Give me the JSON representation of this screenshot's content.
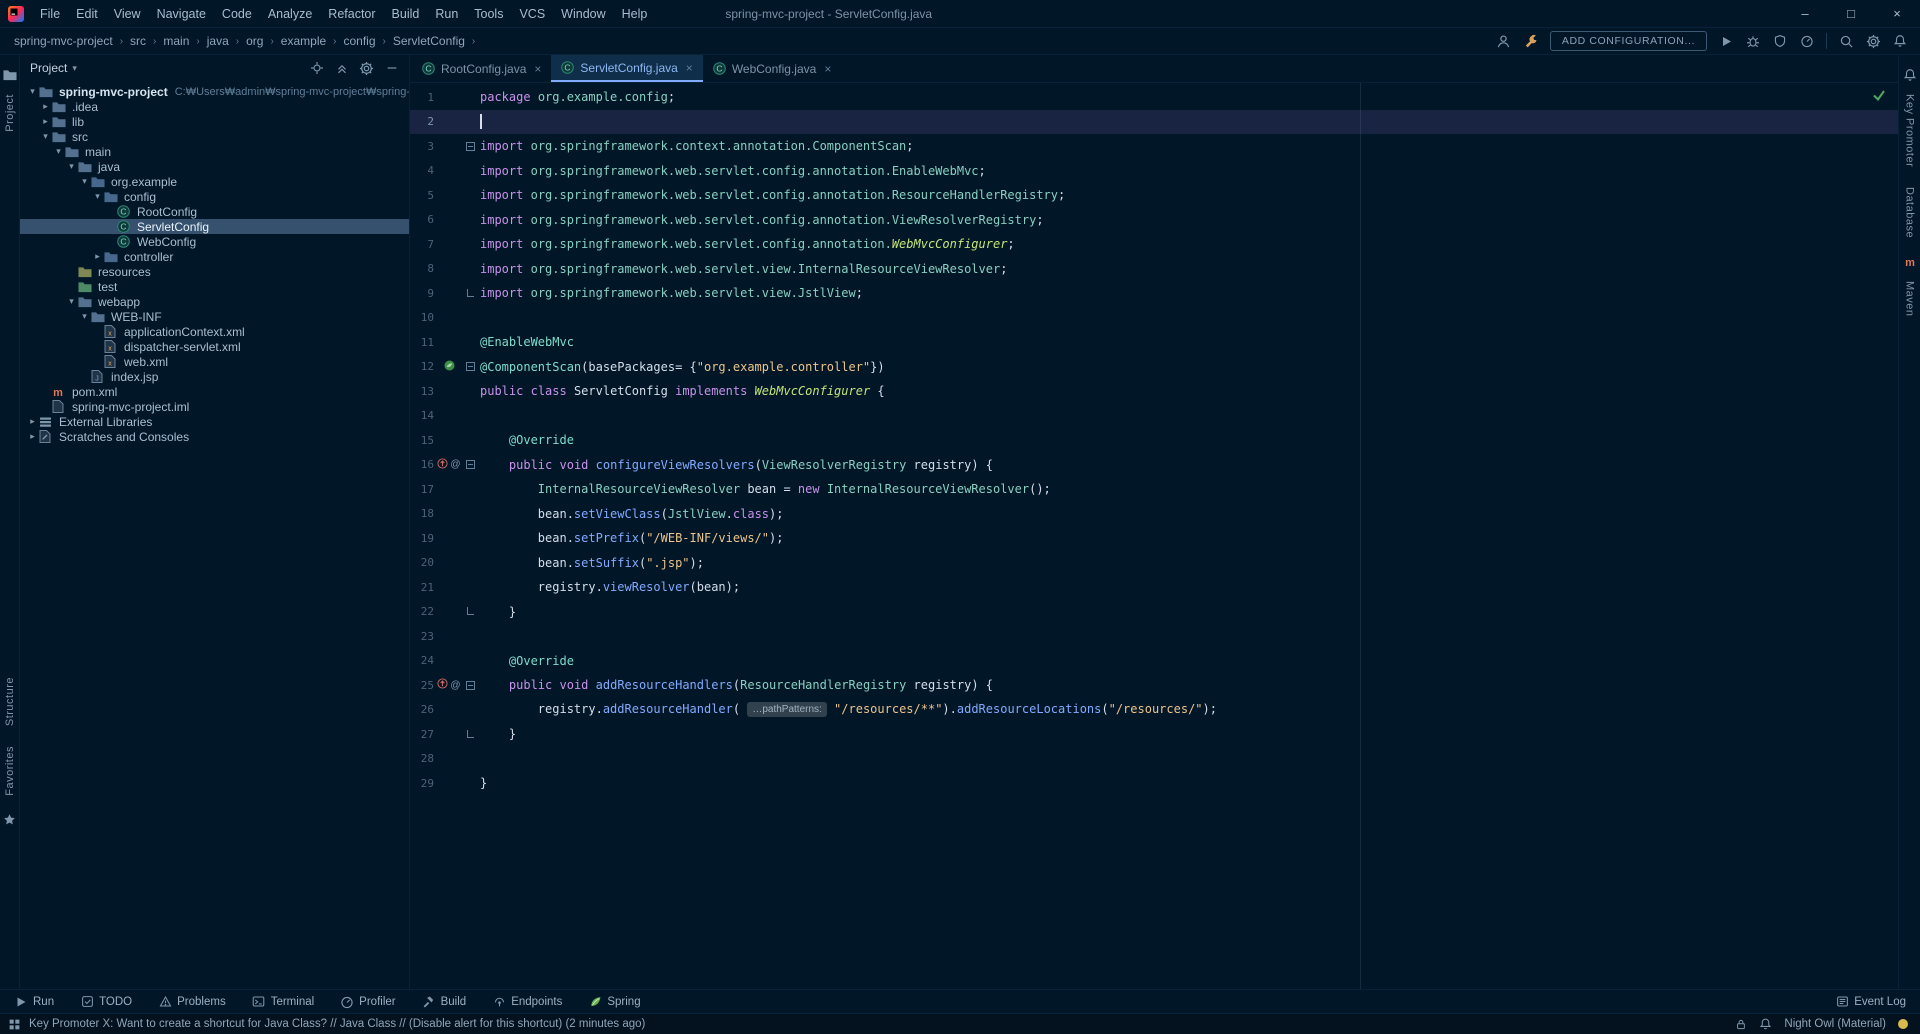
{
  "colors": {
    "bg": "#011627",
    "accent": "#82aaff",
    "keyword": "#c792ea",
    "string": "#ecc48d",
    "type": "#88d0c0",
    "interface": "#c5e478",
    "method": "#82aaff",
    "annotation": "#7fdbca",
    "text": "#d6deeb",
    "caret_line": "rgba(140,100,200,.18)",
    "selection": "#35516d",
    "check_green": "#4fa865",
    "spring_green": "#499c54",
    "theme_dot": "#d7ba4d"
  },
  "window": {
    "menus": [
      "File",
      "Edit",
      "View",
      "Navigate",
      "Code",
      "Analyze",
      "Refactor",
      "Build",
      "Run",
      "Tools",
      "VCS",
      "Window",
      "Help"
    ],
    "title": "spring-mvc-project - ServletConfig.java",
    "controls": {
      "minimize": "–",
      "maximize": "□",
      "close": "×"
    }
  },
  "navbar": {
    "breadcrumbs": [
      "spring-mvc-project",
      "src",
      "main",
      "java",
      "org",
      "example",
      "config",
      "ServletConfig"
    ],
    "separator": "›",
    "tools_left": [
      "user-icon",
      "wrench-icon"
    ],
    "add_configuration_label": "ADD CONFIGURATION...",
    "tools_right": [
      "play-icon",
      "debug-icon",
      "coverage-icon",
      "profiler-icon"
    ],
    "tools_far": [
      "search-icon",
      "settings-icon",
      "bell-icon"
    ]
  },
  "left_stripe": {
    "top_label": "Project",
    "bottom_labels": [
      "Structure",
      "Favorites"
    ]
  },
  "right_stripe": {
    "items": [
      {
        "label": "Key Promoter"
      },
      {
        "label": "Database"
      },
      {
        "label": "Maven",
        "icon": "maven-icon"
      }
    ]
  },
  "project_panel": {
    "title": "Project",
    "header_icons": [
      "locate-icon",
      "collapse-all-icon",
      "settings-icon",
      "hide-icon"
    ],
    "tree": [
      {
        "label": "spring-mvc-project",
        "hint": "C:₩Users₩admin₩spring-mvc-project₩spring-mvc-project",
        "level": 0,
        "icon": "folder-icon",
        "expand": "open",
        "bold": true
      },
      {
        "label": ".idea",
        "level": 1,
        "icon": "folder-icon",
        "expand": "closed"
      },
      {
        "label": "lib",
        "level": 1,
        "icon": "folder-icon",
        "expand": "closed"
      },
      {
        "label": "src",
        "level": 1,
        "icon": "folder-icon",
        "expand": "open"
      },
      {
        "label": "main",
        "level": 2,
        "icon": "folder-icon",
        "expand": "open"
      },
      {
        "label": "java",
        "level": 3,
        "icon": "folder-icon",
        "expand": "open"
      },
      {
        "label": "org.example",
        "level": 4,
        "icon": "package-icon",
        "expand": "open"
      },
      {
        "label": "config",
        "level": 5,
        "icon": "package-icon",
        "expand": "open"
      },
      {
        "label": "RootConfig",
        "level": 6,
        "icon": "class-icon"
      },
      {
        "label": "ServletConfig",
        "level": 6,
        "icon": "class-icon",
        "selected": true
      },
      {
        "label": "WebConfig",
        "level": 6,
        "icon": "class-icon"
      },
      {
        "label": "controller",
        "level": 5,
        "icon": "package-icon",
        "expand": "closed"
      },
      {
        "label": "resources",
        "level": 3,
        "icon": "resources-folder-icon"
      },
      {
        "label": "test",
        "level": 3,
        "icon": "test-folder-icon"
      },
      {
        "label": "webapp",
        "level": 3,
        "icon": "folder-icon",
        "expand": "open"
      },
      {
        "label": "WEB-INF",
        "level": 4,
        "icon": "folder-icon",
        "expand": "open"
      },
      {
        "label": "applicationContext.xml",
        "level": 5,
        "icon": "xml-file-icon"
      },
      {
        "label": "dispatcher-servlet.xml",
        "level": 5,
        "icon": "xml-file-icon"
      },
      {
        "label": "web.xml",
        "level": 5,
        "icon": "xml-file-icon"
      },
      {
        "label": "index.jsp",
        "level": 4,
        "icon": "jsp-file-icon"
      },
      {
        "label": "pom.xml",
        "level": 1,
        "icon": "maven-icon"
      },
      {
        "label": "spring-mvc-project.iml",
        "level": 1,
        "icon": "iml-file-icon"
      },
      {
        "label": "External Libraries",
        "level": 0,
        "icon": "libraries-icon",
        "expand": "closed"
      },
      {
        "label": "Scratches and Consoles",
        "level": 0,
        "icon": "scratches-icon",
        "expand": "closed"
      }
    ]
  },
  "editor": {
    "tabs": [
      {
        "label": "RootConfig.java",
        "active": false
      },
      {
        "label": "ServletConfig.java",
        "active": true
      },
      {
        "label": "WebConfig.java",
        "active": false
      }
    ],
    "lines": [
      {
        "n": 1,
        "tokens": [
          [
            "k",
            "package"
          ],
          [
            "d",
            " "
          ],
          [
            "t",
            "org.example.config"
          ],
          [
            "d",
            ";"
          ]
        ]
      },
      {
        "n": 2,
        "tokens": [],
        "caret": true
      },
      {
        "n": 3,
        "fold": "open",
        "tokens": [
          [
            "k",
            "import"
          ],
          [
            "d",
            " "
          ],
          [
            "t",
            "org.springframework.context.annotation.ComponentScan"
          ],
          [
            "d",
            ";"
          ]
        ]
      },
      {
        "n": 4,
        "tokens": [
          [
            "k",
            "import"
          ],
          [
            "d",
            " "
          ],
          [
            "t",
            "org.springframework.web.servlet.config.annotation.EnableWebMvc"
          ],
          [
            "d",
            ";"
          ]
        ]
      },
      {
        "n": 5,
        "tokens": [
          [
            "k",
            "import"
          ],
          [
            "d",
            " "
          ],
          [
            "t",
            "org.springframework.web.servlet.config.annotation.ResourceHandlerRegistry"
          ],
          [
            "d",
            ";"
          ]
        ]
      },
      {
        "n": 6,
        "tokens": [
          [
            "k",
            "import"
          ],
          [
            "d",
            " "
          ],
          [
            "t",
            "org.springframework.web.servlet.config.annotation.ViewResolverRegistry"
          ],
          [
            "d",
            ";"
          ]
        ]
      },
      {
        "n": 7,
        "tokens": [
          [
            "k",
            "import"
          ],
          [
            "d",
            " "
          ],
          [
            "t",
            "org.springframework.web.servlet.config.annotation."
          ],
          [
            "i",
            "WebMvcConfigurer"
          ],
          [
            "d",
            ";"
          ]
        ]
      },
      {
        "n": 8,
        "tokens": [
          [
            "k",
            "import"
          ],
          [
            "d",
            " "
          ],
          [
            "t",
            "org.springframework.web.servlet.view.InternalResourceViewResolver"
          ],
          [
            "d",
            ";"
          ]
        ]
      },
      {
        "n": 9,
        "fold": "end",
        "tokens": [
          [
            "k",
            "import"
          ],
          [
            "d",
            " "
          ],
          [
            "t",
            "org.springframework.web.servlet.view.JstlView"
          ],
          [
            "d",
            ";"
          ]
        ]
      },
      {
        "n": 10,
        "tokens": []
      },
      {
        "n": 11,
        "tokens": [
          [
            "a",
            "@EnableWebMvc"
          ]
        ]
      },
      {
        "n": 12,
        "gutter": "spring",
        "fold": "open",
        "tokens": [
          [
            "a",
            "@ComponentScan"
          ],
          [
            "d",
            "(basePackages= {"
          ],
          [
            "s",
            "\"org.example.controller\""
          ],
          [
            "d",
            "})"
          ]
        ]
      },
      {
        "n": 13,
        "tokens": [
          [
            "k",
            "public"
          ],
          [
            "d",
            " "
          ],
          [
            "k",
            "class"
          ],
          [
            "d",
            " ServletConfig "
          ],
          [
            "k",
            "implements"
          ],
          [
            "d",
            " "
          ],
          [
            "i",
            "WebMvcConfigurer"
          ],
          [
            "d",
            " {"
          ]
        ]
      },
      {
        "n": 14,
        "tokens": []
      },
      {
        "n": 15,
        "tokens": [
          [
            "d",
            "    "
          ],
          [
            "a",
            "@Override"
          ]
        ]
      },
      {
        "n": 16,
        "gutter": "override",
        "fold": "open",
        "tokens": [
          [
            "d",
            "    "
          ],
          [
            "k",
            "public"
          ],
          [
            "d",
            " "
          ],
          [
            "k",
            "void"
          ],
          [
            "d",
            " "
          ],
          [
            "f",
            "configureViewResolvers"
          ],
          [
            "d",
            "("
          ],
          [
            "t",
            "ViewResolverRegistry"
          ],
          [
            "d",
            " registry) {"
          ]
        ]
      },
      {
        "n": 17,
        "tokens": [
          [
            "d",
            "        "
          ],
          [
            "t",
            "InternalResourceViewResolver"
          ],
          [
            "d",
            " bean = "
          ],
          [
            "k",
            "new"
          ],
          [
            "d",
            " "
          ],
          [
            "t",
            "InternalResourceViewResolver"
          ],
          [
            "d",
            "();"
          ]
        ]
      },
      {
        "n": 18,
        "tokens": [
          [
            "d",
            "        bean."
          ],
          [
            "f",
            "setViewClass"
          ],
          [
            "d",
            "("
          ],
          [
            "t",
            "JstlView"
          ],
          [
            "d",
            "."
          ],
          [
            "k",
            "class"
          ],
          [
            "d",
            ");"
          ]
        ]
      },
      {
        "n": 19,
        "tokens": [
          [
            "d",
            "        bean."
          ],
          [
            "f",
            "setPrefix"
          ],
          [
            "d",
            "("
          ],
          [
            "s",
            "\"/WEB-INF/views/\""
          ],
          [
            "d",
            ");"
          ]
        ]
      },
      {
        "n": 20,
        "tokens": [
          [
            "d",
            "        bean."
          ],
          [
            "f",
            "setSuffix"
          ],
          [
            "d",
            "("
          ],
          [
            "s",
            "\".jsp\""
          ],
          [
            "d",
            ");"
          ]
        ]
      },
      {
        "n": 21,
        "tokens": [
          [
            "d",
            "        registry."
          ],
          [
            "f",
            "viewResolver"
          ],
          [
            "d",
            "(bean);"
          ]
        ]
      },
      {
        "n": 22,
        "fold": "end",
        "tokens": [
          [
            "d",
            "    }"
          ]
        ]
      },
      {
        "n": 23,
        "tokens": []
      },
      {
        "n": 24,
        "tokens": [
          [
            "d",
            "    "
          ],
          [
            "a",
            "@Override"
          ]
        ]
      },
      {
        "n": 25,
        "gutter": "override",
        "fold": "open",
        "tokens": [
          [
            "d",
            "    "
          ],
          [
            "k",
            "public"
          ],
          [
            "d",
            " "
          ],
          [
            "k",
            "void"
          ],
          [
            "d",
            " "
          ],
          [
            "f",
            "addResourceHandlers"
          ],
          [
            "d",
            "("
          ],
          [
            "t",
            "ResourceHandlerRegistry"
          ],
          [
            "d",
            " registry) {"
          ]
        ]
      },
      {
        "n": 26,
        "tokens": [
          [
            "d",
            "        registry."
          ],
          [
            "f",
            "addResourceHandler"
          ],
          [
            "d",
            "( "
          ],
          [
            "h",
            "…pathPatterns:"
          ],
          [
            "d",
            " "
          ],
          [
            "s",
            "\"/resources/**\""
          ],
          [
            "d",
            ")."
          ],
          [
            "f",
            "addResourceLocations"
          ],
          [
            "d",
            "("
          ],
          [
            "s",
            "\"/resources/\""
          ],
          [
            "d",
            ");"
          ]
        ]
      },
      {
        "n": 27,
        "fold": "end",
        "tokens": [
          [
            "d",
            "    }"
          ]
        ]
      },
      {
        "n": 28,
        "tokens": []
      },
      {
        "n": 29,
        "tokens": [
          [
            "d",
            "}"
          ]
        ]
      }
    ]
  },
  "bottom_bar": {
    "items": [
      {
        "label": "Run",
        "icon": "run-icon"
      },
      {
        "label": "TODO",
        "icon": "todo-icon"
      },
      {
        "label": "Problems",
        "icon": "problems-icon"
      },
      {
        "label": "Terminal",
        "icon": "terminal-icon"
      },
      {
        "label": "Profiler",
        "icon": "profiler-icon"
      },
      {
        "label": "Build",
        "icon": "build-icon"
      },
      {
        "label": "Endpoints",
        "icon": "endpoints-icon"
      },
      {
        "label": "Spring",
        "icon": "spring-icon"
      }
    ],
    "right": [
      {
        "label": "Event Log",
        "icon": "eventlog-icon"
      }
    ]
  },
  "status_bar": {
    "message": "Key Promoter X: Want to create a shortcut for Java Class? // Java Class // (Disable alert for this shortcut) (2 minutes ago)",
    "theme": "Night Owl (Material)"
  }
}
